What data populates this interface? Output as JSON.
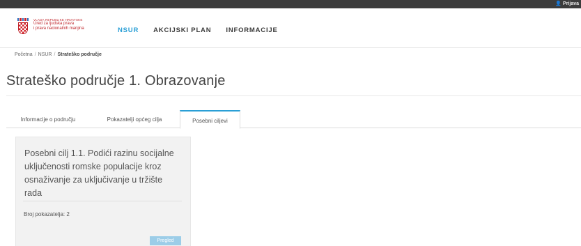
{
  "topbar": {
    "login_label": "👤 Prijava"
  },
  "logo": {
    "line1": "VLADA REPUBLIKE HRVATSKE",
    "line2": "Ured za ljudska prava",
    "line3": "i prava nacionalnih manjina"
  },
  "nav": {
    "items": [
      {
        "label": "NSUR",
        "active": true
      },
      {
        "label": "AKCIJSKI PLAN",
        "active": false
      },
      {
        "label": "INFORMACIJE",
        "active": false
      }
    ]
  },
  "breadcrumb": {
    "items": [
      "Početna",
      "NSUR",
      "Strateško područje"
    ]
  },
  "page": {
    "title": "Strateško područje 1. Obrazovanje"
  },
  "tabs": [
    {
      "label": "Informacije o području",
      "active": false
    },
    {
      "label": "Pokazatelji općeg cilja",
      "active": false
    },
    {
      "label": "Posebni ciljevi",
      "active": true
    }
  ],
  "card": {
    "title": "Posebni cilj 1.1. Podići razinu socijalne uključenosti romske populacije kroz osnaživanje za uključivanje u tržište rada",
    "meta": "Broj pokazatelja: 2",
    "button_label": "Pregled"
  },
  "colors": {
    "accent": "#2a9fd6",
    "brand_red": "#c0272d",
    "topbar": "#3c3c3c",
    "button": "#9ccde8"
  }
}
